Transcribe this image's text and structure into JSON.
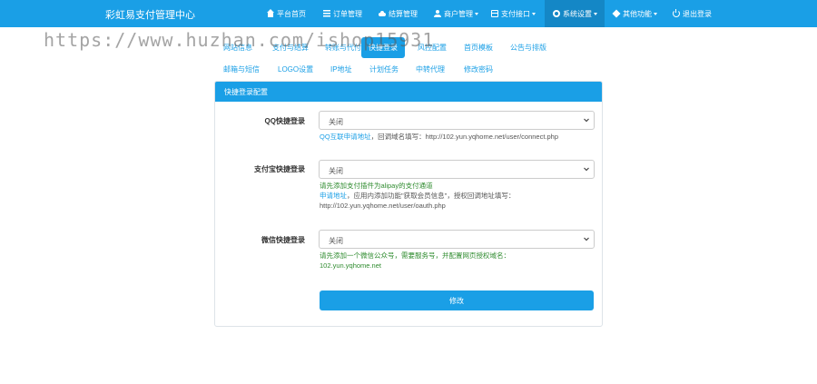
{
  "header": {
    "brand": "彩虹易支付管理中心",
    "nav": [
      {
        "label": "平台首页",
        "icon": "home-icon"
      },
      {
        "label": "订单管理",
        "icon": "list-icon"
      },
      {
        "label": "结算管理",
        "icon": "cloud-icon"
      },
      {
        "label": "商户管理",
        "icon": "user-icon"
      },
      {
        "label": "支付接口",
        "icon": "card-icon"
      },
      {
        "label": "系统设置",
        "icon": "gear-icon"
      },
      {
        "label": "其他功能",
        "icon": "cube-icon"
      },
      {
        "label": "退出登录",
        "icon": "power-icon"
      }
    ]
  },
  "watermark": "https://www.huzhan.com/ishop15931",
  "tabs": {
    "row1": [
      "网站信息",
      "支付与结算",
      "转账与代付",
      "快捷登录",
      "风控配置",
      "首页模板",
      "公告与排版"
    ],
    "row2": [
      "邮箱与短信",
      "LOGO设置",
      "IP地址",
      "计划任务",
      "中转代理",
      "修改密码"
    ]
  },
  "panel": {
    "title": "快捷登录配置",
    "qq": {
      "label": "QQ快捷登录",
      "value": "关闭",
      "help_link": "QQ互联申请地址",
      "help_text": "，回调域名填写：http://102.yun.yqhome.net/user/connect.php"
    },
    "alipay": {
      "label": "支付宝快捷登录",
      "value": "关闭",
      "help_line1": "请先添加支付插件为alipay的支付通道",
      "help_link": "申请地址",
      "help_text": "，应用内添加功能\"获取会员信息\"，授权回调地址填写：",
      "help_url": "http://102.yun.yqhome.net/user/oauth.php"
    },
    "wechat": {
      "label": "微信快捷登录",
      "value": "关闭",
      "help_line1": "请先添加一个微信公众号，需要服务号，并配置网页授权域名：",
      "help_line2": "102.yun.yqhome.net"
    },
    "submit_label": "修改"
  },
  "colors": {
    "primary": "#1a9fe6",
    "nav_active": "#1487c6",
    "hint_green": "#2e8b2e"
  }
}
